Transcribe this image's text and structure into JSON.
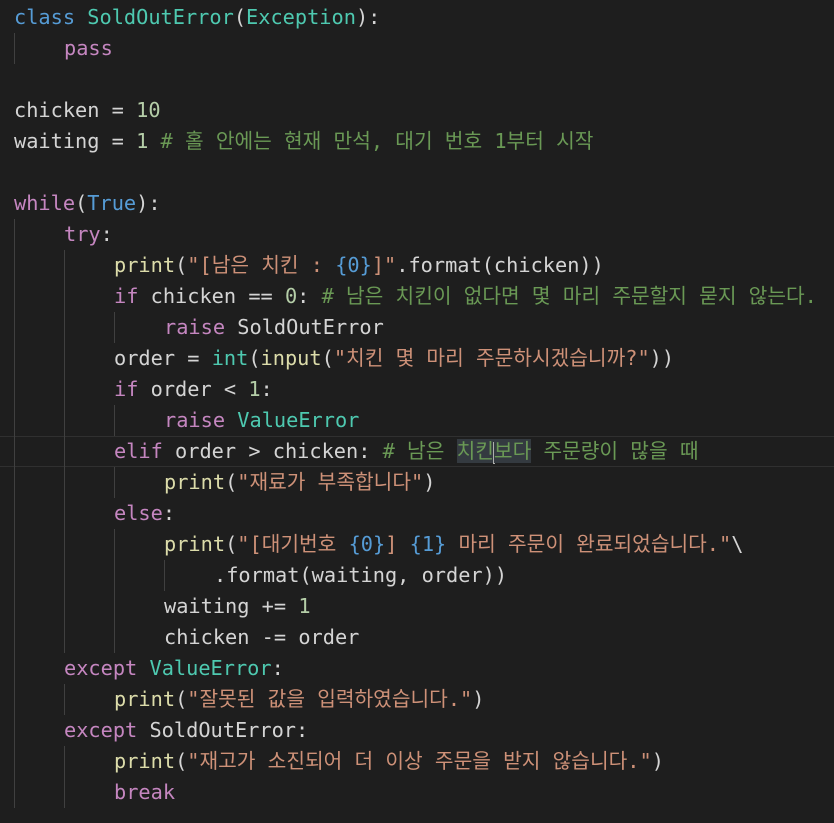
{
  "editor": {
    "theme_colors": {
      "background": "#1e1e1e",
      "keyword_blue": "#569cd6",
      "control_purple": "#c586c0",
      "function_yellow": "#dcdcaa",
      "class_teal": "#4ec9b0",
      "string_orange": "#ce9178",
      "number_green": "#b5cea8",
      "comment_green": "#6a9955",
      "variable_light_blue": "#9cdcfe",
      "default_text": "#d4d4d4"
    },
    "lines": [
      {
        "indent": 0,
        "current": false,
        "tokens": [
          {
            "t": "class",
            "c": "#569cd6"
          },
          {
            "t": " ",
            "c": "#d4d4d4"
          },
          {
            "t": "SoldOutError",
            "c": "#4ec9b0"
          },
          {
            "t": "(",
            "c": "#d4d4d4"
          },
          {
            "t": "Exception",
            "c": "#4ec9b0"
          },
          {
            "t": "):",
            "c": "#d4d4d4"
          }
        ]
      },
      {
        "indent": 1,
        "current": false,
        "tokens": [
          {
            "t": "pass",
            "c": "#c586c0"
          }
        ]
      },
      {
        "indent": 0,
        "current": false,
        "tokens": []
      },
      {
        "indent": 0,
        "current": false,
        "tokens": [
          {
            "t": "chicken = ",
            "c": "#d4d4d4"
          },
          {
            "t": "10",
            "c": "#b5cea8"
          }
        ]
      },
      {
        "indent": 0,
        "current": false,
        "tokens": [
          {
            "t": "waiting = ",
            "c": "#d4d4d4"
          },
          {
            "t": "1",
            "c": "#b5cea8"
          },
          {
            "t": " # 홀 안에는 현재 만석, 대기 번호 1부터 시작",
            "c": "#6a9955"
          }
        ]
      },
      {
        "indent": 0,
        "current": false,
        "tokens": []
      },
      {
        "indent": 0,
        "current": false,
        "tokens": [
          {
            "t": "while",
            "c": "#c586c0"
          },
          {
            "t": "(",
            "c": "#d4d4d4"
          },
          {
            "t": "True",
            "c": "#569cd6"
          },
          {
            "t": "):",
            "c": "#d4d4d4"
          }
        ]
      },
      {
        "indent": 1,
        "current": false,
        "tokens": [
          {
            "t": "try",
            "c": "#c586c0"
          },
          {
            "t": ":",
            "c": "#d4d4d4"
          }
        ]
      },
      {
        "indent": 2,
        "current": false,
        "tokens": [
          {
            "t": "print",
            "c": "#dcdcaa"
          },
          {
            "t": "(",
            "c": "#d4d4d4"
          },
          {
            "t": "\"[남은 치킨 : ",
            "c": "#ce9178"
          },
          {
            "t": "{0}",
            "c": "#569cd6"
          },
          {
            "t": "]\"",
            "c": "#ce9178"
          },
          {
            "t": ".format(chicken))",
            "c": "#d4d4d4"
          }
        ]
      },
      {
        "indent": 2,
        "current": false,
        "tokens": [
          {
            "t": "if",
            "c": "#c586c0"
          },
          {
            "t": " chicken == ",
            "c": "#d4d4d4"
          },
          {
            "t": "0",
            "c": "#b5cea8"
          },
          {
            "t": ": ",
            "c": "#d4d4d4"
          },
          {
            "t": "# 남은 치킨이 없다면 몇 마리 주문할지 묻지 않는다.",
            "c": "#6a9955"
          }
        ]
      },
      {
        "indent": 3,
        "current": false,
        "tokens": [
          {
            "t": "raise",
            "c": "#c586c0"
          },
          {
            "t": " SoldOutError",
            "c": "#d4d4d4"
          }
        ]
      },
      {
        "indent": 2,
        "current": false,
        "tokens": [
          {
            "t": "order = ",
            "c": "#d4d4d4"
          },
          {
            "t": "int",
            "c": "#4ec9b0"
          },
          {
            "t": "(",
            "c": "#d4d4d4"
          },
          {
            "t": "input",
            "c": "#dcdcaa"
          },
          {
            "t": "(",
            "c": "#d4d4d4"
          },
          {
            "t": "\"치킨 몇 마리 주문하시겠습니까?\"",
            "c": "#ce9178"
          },
          {
            "t": "))",
            "c": "#d4d4d4"
          }
        ]
      },
      {
        "indent": 2,
        "current": false,
        "tokens": [
          {
            "t": "if",
            "c": "#c586c0"
          },
          {
            "t": " order < ",
            "c": "#d4d4d4"
          },
          {
            "t": "1",
            "c": "#b5cea8"
          },
          {
            "t": ":",
            "c": "#d4d4d4"
          }
        ]
      },
      {
        "indent": 3,
        "current": false,
        "tokens": [
          {
            "t": "raise",
            "c": "#c586c0"
          },
          {
            "t": " ",
            "c": "#d4d4d4"
          },
          {
            "t": "ValueError",
            "c": "#4ec9b0"
          }
        ]
      },
      {
        "indent": 2,
        "current": true,
        "tokens": [
          {
            "t": "elif",
            "c": "#c586c0"
          },
          {
            "t": " order > chicken: ",
            "c": "#d4d4d4"
          },
          {
            "t": "# 남은 ",
            "c": "#6a9955"
          },
          {
            "t": "치킨",
            "c": "#6a9955",
            "hl": true
          },
          {
            "caret": true
          },
          {
            "t": "보다",
            "c": "#6a9955",
            "hl": true
          },
          {
            "t": " 주문량이 많을 때",
            "c": "#6a9955"
          }
        ]
      },
      {
        "indent": 3,
        "current": false,
        "tokens": [
          {
            "t": "print",
            "c": "#dcdcaa"
          },
          {
            "t": "(",
            "c": "#d4d4d4"
          },
          {
            "t": "\"재료가 부족합니다\"",
            "c": "#ce9178"
          },
          {
            "t": ")",
            "c": "#d4d4d4"
          }
        ]
      },
      {
        "indent": 2,
        "current": false,
        "tokens": [
          {
            "t": "else",
            "c": "#c586c0"
          },
          {
            "t": ":",
            "c": "#d4d4d4"
          }
        ]
      },
      {
        "indent": 3,
        "current": false,
        "tokens": [
          {
            "t": "print",
            "c": "#dcdcaa"
          },
          {
            "t": "(",
            "c": "#d4d4d4"
          },
          {
            "t": "\"[대기번호 ",
            "c": "#ce9178"
          },
          {
            "t": "{0}",
            "c": "#569cd6"
          },
          {
            "t": "] ",
            "c": "#ce9178"
          },
          {
            "t": "{1}",
            "c": "#569cd6"
          },
          {
            "t": " 마리 주문이 완료되었습니다.\"",
            "c": "#ce9178"
          },
          {
            "t": "\\",
            "c": "#d4d4d4"
          }
        ]
      },
      {
        "indent": 4,
        "current": false,
        "tokens": [
          {
            "t": ".format(waiting, order))",
            "c": "#d4d4d4"
          }
        ]
      },
      {
        "indent": 3,
        "current": false,
        "tokens": [
          {
            "t": "waiting += ",
            "c": "#d4d4d4"
          },
          {
            "t": "1",
            "c": "#b5cea8"
          }
        ]
      },
      {
        "indent": 3,
        "current": false,
        "tokens": [
          {
            "t": "chicken -= order",
            "c": "#d4d4d4"
          }
        ]
      },
      {
        "indent": 1,
        "current": false,
        "tokens": [
          {
            "t": "except",
            "c": "#c586c0"
          },
          {
            "t": " ",
            "c": "#d4d4d4"
          },
          {
            "t": "ValueError",
            "c": "#4ec9b0"
          },
          {
            "t": ":",
            "c": "#d4d4d4"
          }
        ]
      },
      {
        "indent": 2,
        "current": false,
        "tokens": [
          {
            "t": "print",
            "c": "#dcdcaa"
          },
          {
            "t": "(",
            "c": "#d4d4d4"
          },
          {
            "t": "\"잘못된 값을 입력하였습니다.\"",
            "c": "#ce9178"
          },
          {
            "t": ")",
            "c": "#d4d4d4"
          }
        ]
      },
      {
        "indent": 1,
        "current": false,
        "tokens": [
          {
            "t": "except",
            "c": "#c586c0"
          },
          {
            "t": " SoldOutError:",
            "c": "#d4d4d4"
          }
        ]
      },
      {
        "indent": 2,
        "current": false,
        "tokens": [
          {
            "t": "print",
            "c": "#dcdcaa"
          },
          {
            "t": "(",
            "c": "#d4d4d4"
          },
          {
            "t": "\"재고가 소진되어 더 이상 주문을 받지 않습니다.\"",
            "c": "#ce9178"
          },
          {
            "t": ")",
            "c": "#d4d4d4"
          }
        ]
      },
      {
        "indent": 2,
        "current": false,
        "tokens": [
          {
            "t": "break",
            "c": "#c586c0"
          }
        ]
      }
    ]
  }
}
